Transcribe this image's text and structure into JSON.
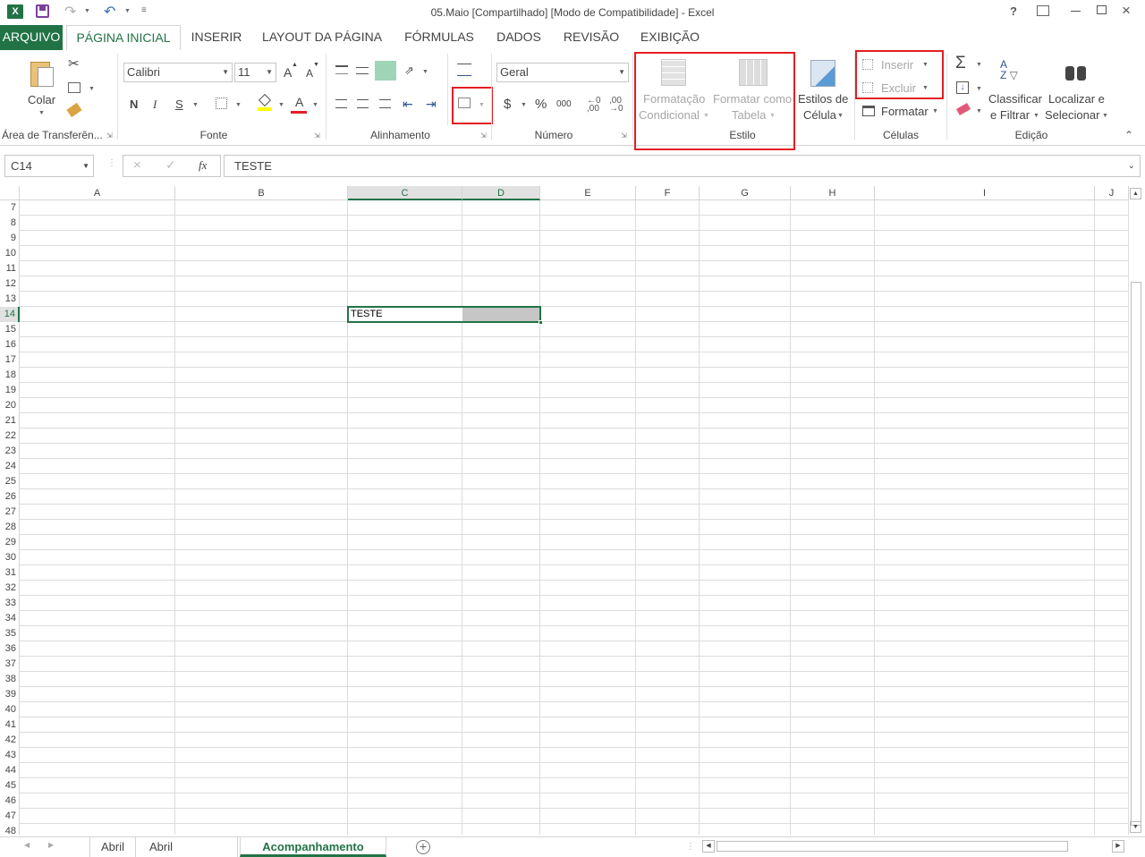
{
  "titlebar": {
    "title": "05.Maio  [Compartilhado]  [Modo de Compatibilidade] - Excel",
    "help": "?",
    "qat_excel_icon": "excel-logo-icon",
    "qat_save_icon": "save-icon",
    "qat_redo_icon": "redo-icon",
    "qat_undo_icon": "undo-icon"
  },
  "tabs": [
    "ARQUIVO",
    "PÁGINA INICIAL",
    "INSERIR",
    "LAYOUT DA PÁGINA",
    "FÓRMULAS",
    "DADOS",
    "REVISÃO",
    "EXIBIÇÃO"
  ],
  "ribbon": {
    "clipboard": {
      "paste": "Colar",
      "label": "Área de Transferên..."
    },
    "font": {
      "name": "Calibri",
      "size": "11",
      "bold": "N",
      "italic": "I",
      "underline": "S",
      "grow": "A",
      "shrink": "A",
      "font_color_letter": "A",
      "label": "Fonte"
    },
    "alignment": {
      "label": "Alinhamento"
    },
    "number": {
      "format": "Geral",
      "currency": "$",
      "percent": "%",
      "thousands": "000",
      "label": "Número"
    },
    "styles": {
      "cond1": "Formatação",
      "cond2": "Condicional",
      "table1": "Formatar como",
      "table2": "Tabela",
      "cell1": "Estilos de",
      "cell2": "Célula",
      "label": "Estilo"
    },
    "cells": {
      "insert": "Inserir",
      "delete": "Excluir",
      "format": "Formatar",
      "label": "Células"
    },
    "editing": {
      "sort1": "Classificar",
      "sort2": "e Filtrar",
      "find1": "Localizar e",
      "find2": "Selecionar",
      "sigma": "Σ",
      "label": "Edição"
    }
  },
  "formula_bar": {
    "name_box": "C14",
    "fx": "fx",
    "value": "TESTE"
  },
  "grid": {
    "columns": [
      "A",
      "B",
      "C",
      "D",
      "E",
      "F",
      "G",
      "H",
      "I",
      "J"
    ],
    "selected_columns": [
      "C",
      "D"
    ],
    "first_row": 7,
    "last_row": 48,
    "selected_row": 14,
    "cell_c14": "TESTE"
  },
  "sheets": [
    "Abril",
    "Abril",
    "Acompanhamento"
  ],
  "colors": {
    "accent": "#217346",
    "highlight_box": "#e31e24"
  }
}
